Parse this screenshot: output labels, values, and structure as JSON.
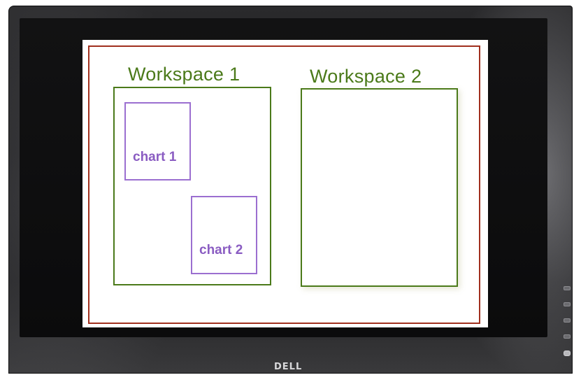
{
  "diagram": {
    "workspaces": [
      {
        "title": "Workspace 1"
      },
      {
        "title": "Workspace 2"
      }
    ],
    "charts": [
      {
        "label": "chart 1"
      },
      {
        "label": "chart 2"
      }
    ]
  },
  "monitor": {
    "brand": "DELL",
    "buttons": [
      "button",
      "button",
      "button",
      "button",
      "power-button"
    ]
  },
  "colors": {
    "outer_frame": "#a0301e",
    "workspace": "#4b7a1a",
    "chart": "#9b6fd0",
    "bezel": "#1b1b1d"
  }
}
